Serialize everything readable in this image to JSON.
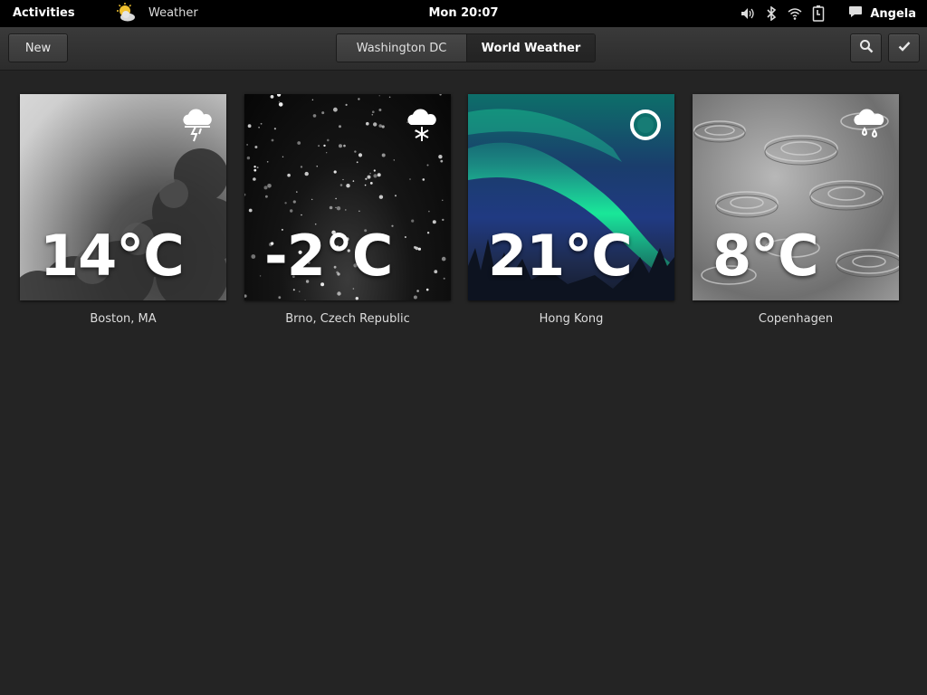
{
  "topbar": {
    "activities": "Activities",
    "app_name": "Weather",
    "clock": "Mon 20:07",
    "user": "Angela"
  },
  "header": {
    "new_label": "New",
    "tabs": [
      {
        "label": "Washington DC",
        "active": false
      },
      {
        "label": "World Weather",
        "active": true
      }
    ]
  },
  "locations": [
    {
      "temperature": "14°C",
      "name": "Boston, MA",
      "condition_icon": "thunderstorm-icon"
    },
    {
      "temperature": "-2°C",
      "name": "Brno, Czech Republic",
      "condition_icon": "snow-icon"
    },
    {
      "temperature": "21°C",
      "name": "Hong Kong",
      "condition_icon": "clear-night-icon"
    },
    {
      "temperature": "8°C",
      "name": "Copenhagen",
      "condition_icon": "showers-icon"
    }
  ],
  "colors": {
    "background": "#242424",
    "topbar": "#000000",
    "headerbar": "#333333"
  }
}
